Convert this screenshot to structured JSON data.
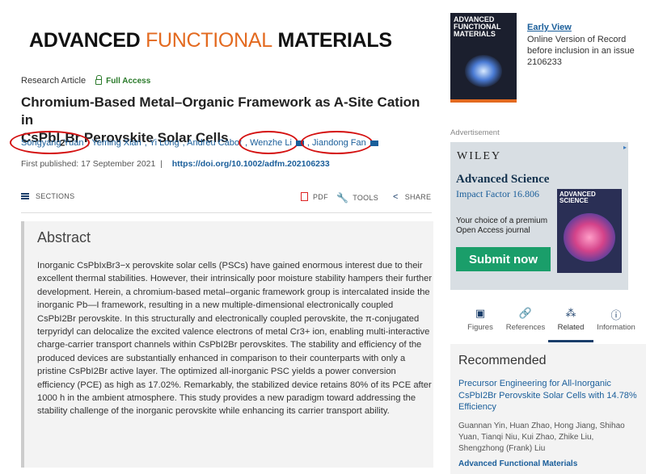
{
  "journal": {
    "logo_part1": "ADVANCED",
    "logo_part2": "FUNCTIONAL",
    "logo_part3": "MATERIALS"
  },
  "article": {
    "type": "Research Article",
    "access": "Full Access",
    "title_line1": "Chromium-Based Metal–Organic Framework as A-Site Cation in",
    "title_line2_pre": "CsPbI",
    "title_line2_sub": "2",
    "title_line2_post": "Br Perovskite Solar Cells",
    "authors": [
      "Songyang Yuan",
      "Yeming Xian",
      "Yi Long",
      "Andreu Cabot",
      "Wenzhe Li",
      "Jiandong Fan"
    ],
    "published_label": "First published:",
    "published_date": "17 September 2021",
    "doi": "https://doi.org/10.1002/adfm.202106233"
  },
  "toolbar": {
    "sections": "SECTIONS",
    "pdf": "PDF",
    "tools": "TOOLS",
    "share": "SHARE"
  },
  "abstract": {
    "heading": "Abstract",
    "text": "Inorganic CsPbIxBr3−x perovskite solar cells (PSCs) have gained enormous interest due to their excellent thermal stabilities. However, their intrinsically poor moisture stability hampers their further development. Herein, a chromium-based metal–organic framework group is intercalated inside the inorganic Pb—I framework, resulting in a new multiple-dimensional electronically coupled CsPbI2Br perovskite. In this structurally and electronically coupled perovskite, the π-conjugated terpyridyl can delocalize the excited valence electrons of metal Cr3+ ion, enabling multi-interactive charge-carrier transport channels within CsPbI2Br perovskites. The stability and efficiency of the produced devices are substantially enhanced in comparison to their counterparts with only a pristine CsPbI2Br active layer. The optimized all-inorganic PSC yields a power conversion efficiency (PCE) as high as 17.02%. Remarkably, the stabilized device retains 80% of its PCE after 1000 h in the ambient atmosphere. This study provides a new paradigm toward addressing the stability challenge of the inorganic perovskite while enhancing its carrier transport ability."
  },
  "cover": {
    "title_line1": "ADVANCED",
    "title_line2": "FUNCTIONAL",
    "title_line3": "MATERIALS"
  },
  "early_view": {
    "link": "Early View",
    "line1": "Online Version of Record",
    "line2": "before inclusion in an issue",
    "number": "2106233"
  },
  "advert": {
    "label": "Advertisement",
    "brand": "WILEY",
    "journal": "Advanced Science",
    "impact": "Impact Factor 16.806",
    "tagline": "Your choice of a premium Open Access journal",
    "button": "Submit now",
    "cover_line1": "ADVANCED",
    "cover_line2": "SCIENCE"
  },
  "side_tabs": [
    {
      "label": "Figures",
      "icon": "figures-icon"
    },
    {
      "label": "References",
      "icon": "link-icon"
    },
    {
      "label": "Related",
      "icon": "related-icon"
    },
    {
      "label": "Information",
      "icon": "info-icon"
    }
  ],
  "recommended": {
    "heading": "Recommended",
    "title": "Precursor Engineering for All-Inorganic CsPbI2Br Perovskite Solar Cells with 14.78% Efficiency",
    "authors": "Guannan Yin, Huan Zhao, Hong Jiang, Shihao Yuan, Tianqi Niu, Kui Zhao, Zhike Liu, Shengzhong (Frank) Liu",
    "journal": "Advanced Functional Materials"
  },
  "colors": {
    "accent_orange": "#e36a20",
    "link_blue": "#1a5e9a",
    "annotation_red": "#d41010",
    "submit_green": "#1a9e6a"
  }
}
